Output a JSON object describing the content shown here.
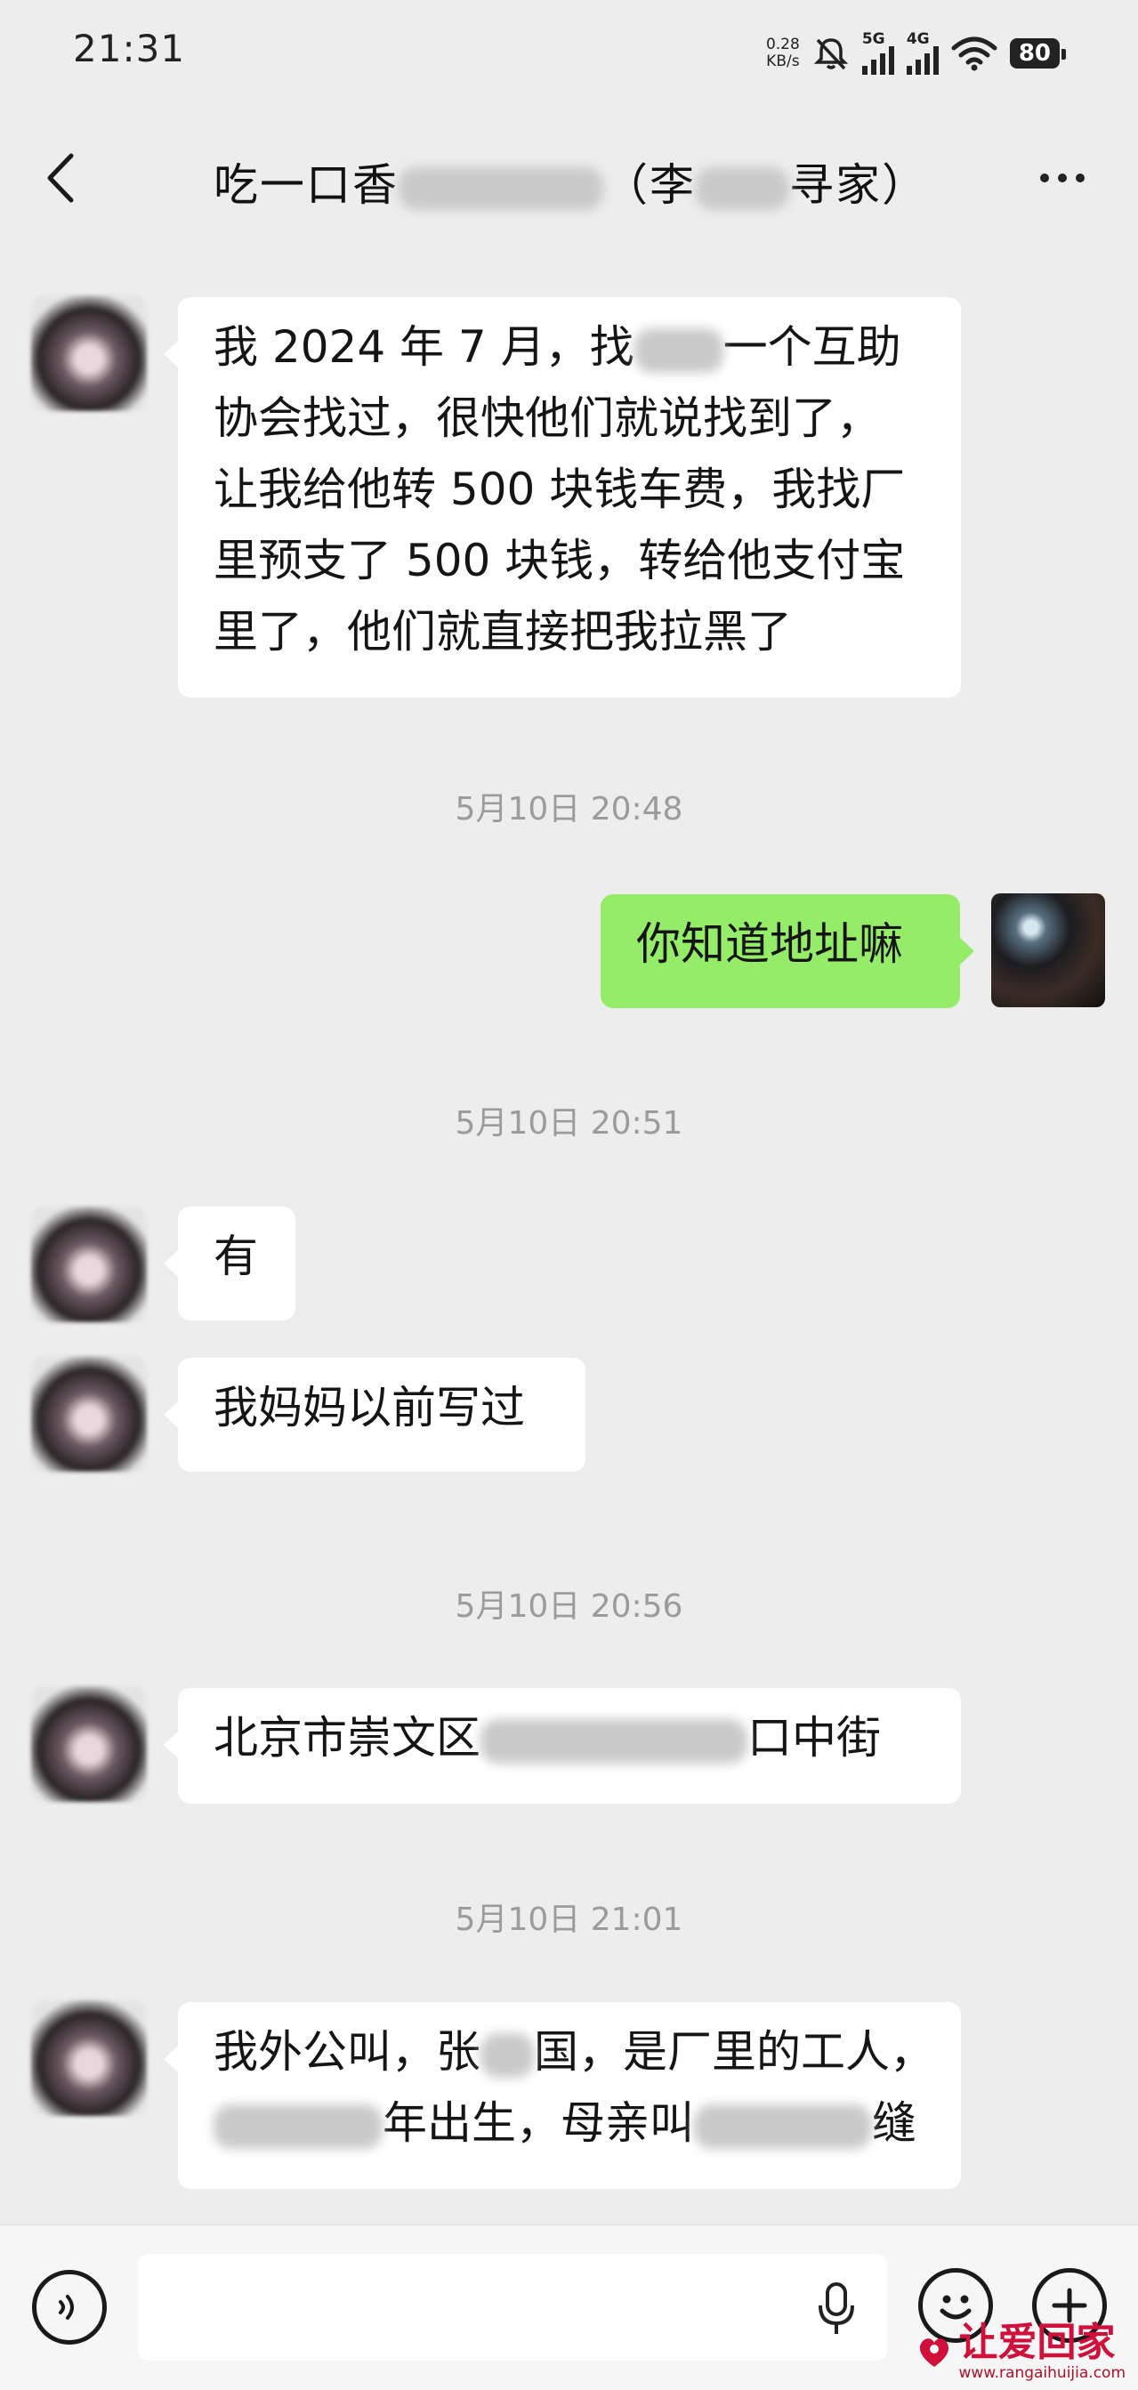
{
  "status_bar": {
    "time": "21:31",
    "net_speed_value": "0.28",
    "net_speed_unit": "KB/s",
    "sim1_label": "5G",
    "sim2_label": "4G",
    "battery": "80"
  },
  "header": {
    "title_part1": "吃一口香",
    "title_part2": "（李",
    "title_part3": "寻家）"
  },
  "messages": [
    {
      "side": "left",
      "lines": [
        "我 2024 年 7 月，找",
        "一个互助",
        "协会找过，很快他们就说找到了，",
        "让我给他转 500 块钱车费，我找厂",
        "里预支了 500 块钱，转给他支付宝",
        "里了，他们就直接把我拉黑了"
      ]
    },
    {
      "timestamp": "5月10日 20:48"
    },
    {
      "side": "right",
      "text": "你知道地址嘛"
    },
    {
      "timestamp": "5月10日 20:51"
    },
    {
      "side": "left",
      "text": "有"
    },
    {
      "side": "left",
      "text": "我妈妈以前写过"
    },
    {
      "timestamp": "5月10日 20:56"
    },
    {
      "side": "left",
      "text_a": "北京市崇文区",
      "text_b": "口中街"
    },
    {
      "timestamp": "5月10日 21:01"
    },
    {
      "side": "left",
      "line1_a": "我外公叫，张",
      "line1_b": "国，是厂里的工人，",
      "line2_a": "年出生，母亲叫",
      "line2_b": "缝"
    }
  ],
  "input_bar": {
    "placeholder": ""
  },
  "watermark": {
    "brand": "让爱回家",
    "url": "www.rangaihuijia.com"
  },
  "colors": {
    "background": "#ededed",
    "outgoing_bubble": "#95ec69",
    "incoming_bubble": "#ffffff",
    "timestamp": "#9b9b9b",
    "watermark": "#d0103a"
  }
}
